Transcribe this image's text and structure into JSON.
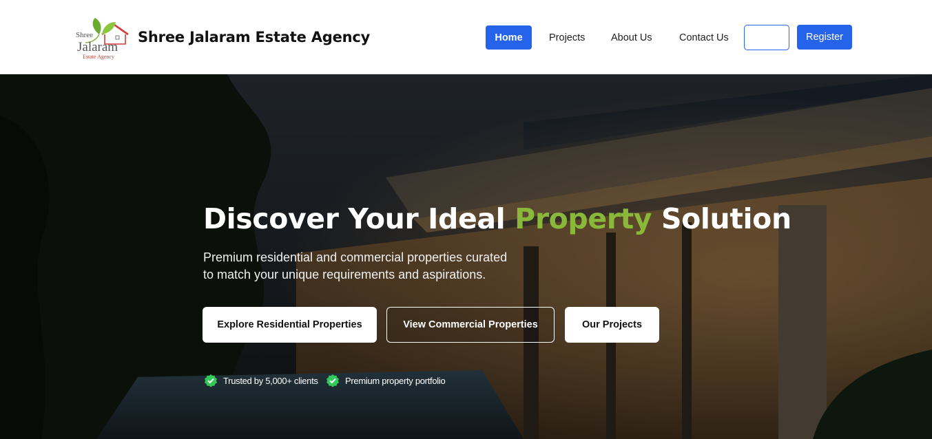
{
  "header": {
    "logo": {
      "text_top": "Shree",
      "text_main": "Jalaram",
      "text_bottom": "Estate Agency"
    },
    "brand_name": "Shree Jalaram Estate Agency",
    "nav": {
      "home": "Home",
      "projects": "Projects",
      "about": "About Us",
      "contact": "Contact Us",
      "login": "",
      "register": "Register"
    }
  },
  "hero": {
    "title_part1": "Discover Your Ideal ",
    "title_accent": "Property",
    "title_part2": " Solution",
    "subtitle": "Premium residential and commercial properties curated to match your unique requirements and aspirations.",
    "buttons": {
      "residential": "Explore Residential Properties",
      "commercial": "View Commercial Properties",
      "projects": "Our Projects"
    },
    "trust": [
      {
        "icon": "check-badge-icon",
        "text": "Trusted by 5,000+ clients"
      },
      {
        "icon": "check-badge-icon",
        "text": "Premium property portfolio"
      }
    ]
  },
  "colors": {
    "primary": "#2563eb",
    "accent": "#8ab83a",
    "check": "#34c759"
  }
}
